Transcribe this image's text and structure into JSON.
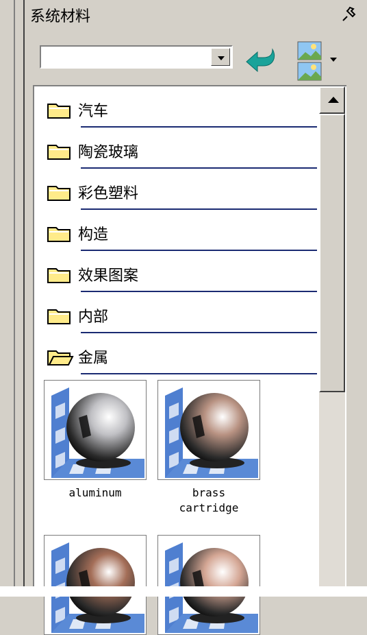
{
  "panel": {
    "title": "系统材料"
  },
  "toolbar": {
    "combo_value": ""
  },
  "folders": [
    {
      "label": "汽车",
      "open": false
    },
    {
      "label": "陶瓷玻璃",
      "open": false
    },
    {
      "label": "彩色塑料",
      "open": false
    },
    {
      "label": "构造",
      "open": false
    },
    {
      "label": "效果图案",
      "open": false
    },
    {
      "label": "内部",
      "open": false
    },
    {
      "label": "金属",
      "open": true
    }
  ],
  "materials": [
    {
      "line1": "aluminum",
      "line2": "",
      "color": "#c0c0c4"
    },
    {
      "line1": "brass",
      "line2": "cartridge",
      "color": "#b89282"
    },
    {
      "line1": "",
      "line2": "",
      "color": "#a46e58"
    },
    {
      "line1": "",
      "line2": "",
      "color": "#d4a694"
    }
  ],
  "colors": {
    "separator": "#1a2a72",
    "folder_fill": "#ffeb8a",
    "arrow": "#1aa39a"
  },
  "icons": [
    "pin-icon",
    "dropdown-arrow-icon",
    "back-arrow-icon",
    "view-mode-icon",
    "folder-icon",
    "folder-open-icon",
    "scroll-up-icon"
  ]
}
